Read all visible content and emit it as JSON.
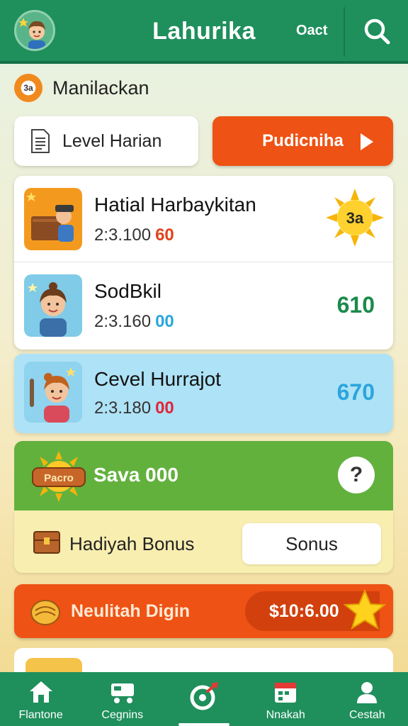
{
  "header": {
    "title": "Lahurika",
    "right_text": "Oact"
  },
  "section": {
    "label": "Manilackan",
    "icon_text": "3a"
  },
  "actions": {
    "level_label": "Level Harian",
    "primary_button": "Pudicniha"
  },
  "list_items": [
    {
      "title": "Hatial Harbaykitan",
      "sub": "2:3.100",
      "highlight": "60",
      "value": "3a",
      "value_type": "sun-badge",
      "color": "#e0421a"
    },
    {
      "title": "SodBkil",
      "sub": "2:3.160",
      "highlight": "00",
      "value": "610",
      "color": "#1b8a4c"
    },
    {
      "title": "Cevel Hurrajot",
      "sub": "2:3.180",
      "highlight": "00",
      "value": "670",
      "color": "#2aa6dd"
    }
  ],
  "highlight_colors": [
    "#e0421a",
    "#2aa6dd",
    "#e0263a"
  ],
  "green_section": {
    "badge_text": "Pacro",
    "label": "Sava 000",
    "help": "?"
  },
  "bonus": {
    "label": "Hadiyah Bonus",
    "button": "Sonus"
  },
  "reward": {
    "label": "Neulitah Digin",
    "amount": "$10:6.00"
  },
  "nav": [
    {
      "label": "Flantone",
      "icon": "home-icon"
    },
    {
      "label": "Cegnins",
      "icon": "cart-icon"
    },
    {
      "label": "",
      "icon": "rocket-icon"
    },
    {
      "label": "Nnakah",
      "icon": "calendar-icon"
    },
    {
      "label": "Cestah",
      "icon": "profile-icon"
    }
  ]
}
